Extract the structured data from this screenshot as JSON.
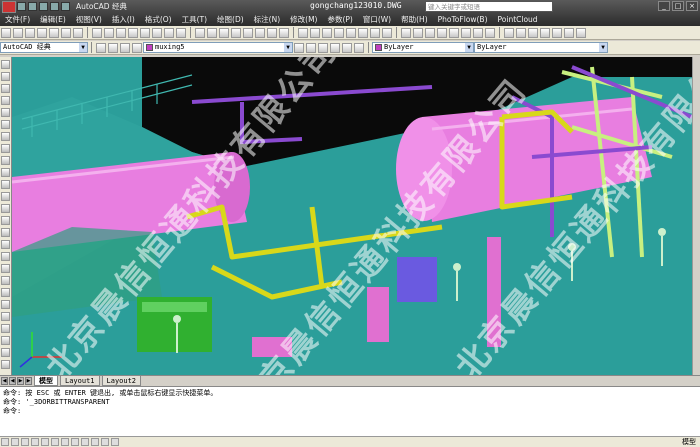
{
  "app": {
    "menus": [
      "文件(F)",
      "编辑(E)",
      "视图(V)",
      "插入(I)",
      "格式(O)",
      "工具(T)",
      "绘图(D)",
      "标注(N)",
      "修改(M)",
      "参数(P)",
      "窗口(W)",
      "帮助(H)",
      "PhoToFlow(B)",
      "PointCloud"
    ],
    "quick_access_label": "AutoCAD 经典",
    "file_title": "gongchang123010.DWG",
    "search_placeholder": "键入关键字或短语"
  },
  "toolbar": {
    "workspace": "AutoCAD 经典",
    "layer": "muxing5",
    "color": "ByLayer",
    "linetype": "ByLayer",
    "color_swatch": "#c040c0"
  },
  "tabs": [
    "模型",
    "Layout1",
    "Layout2"
  ],
  "command": {
    "lines": [
      "命令:  按 ESC 或 ENTER 键退出, 或单击鼠标右键显示快捷菜单。",
      "命令: '_3DORBITTRANSPARENT",
      "命令:"
    ]
  },
  "status": {
    "model_label": "模型"
  },
  "watermark": {
    "text": "北京晨信恒通科技有限公司"
  },
  "scene": {
    "background": "#2b9e9a",
    "vessel_color": "#e87ee0",
    "pipe_yellow": "#d8d81a",
    "pipe_purple": "#8a4ad0",
    "pipe_green": "#a8e060"
  }
}
